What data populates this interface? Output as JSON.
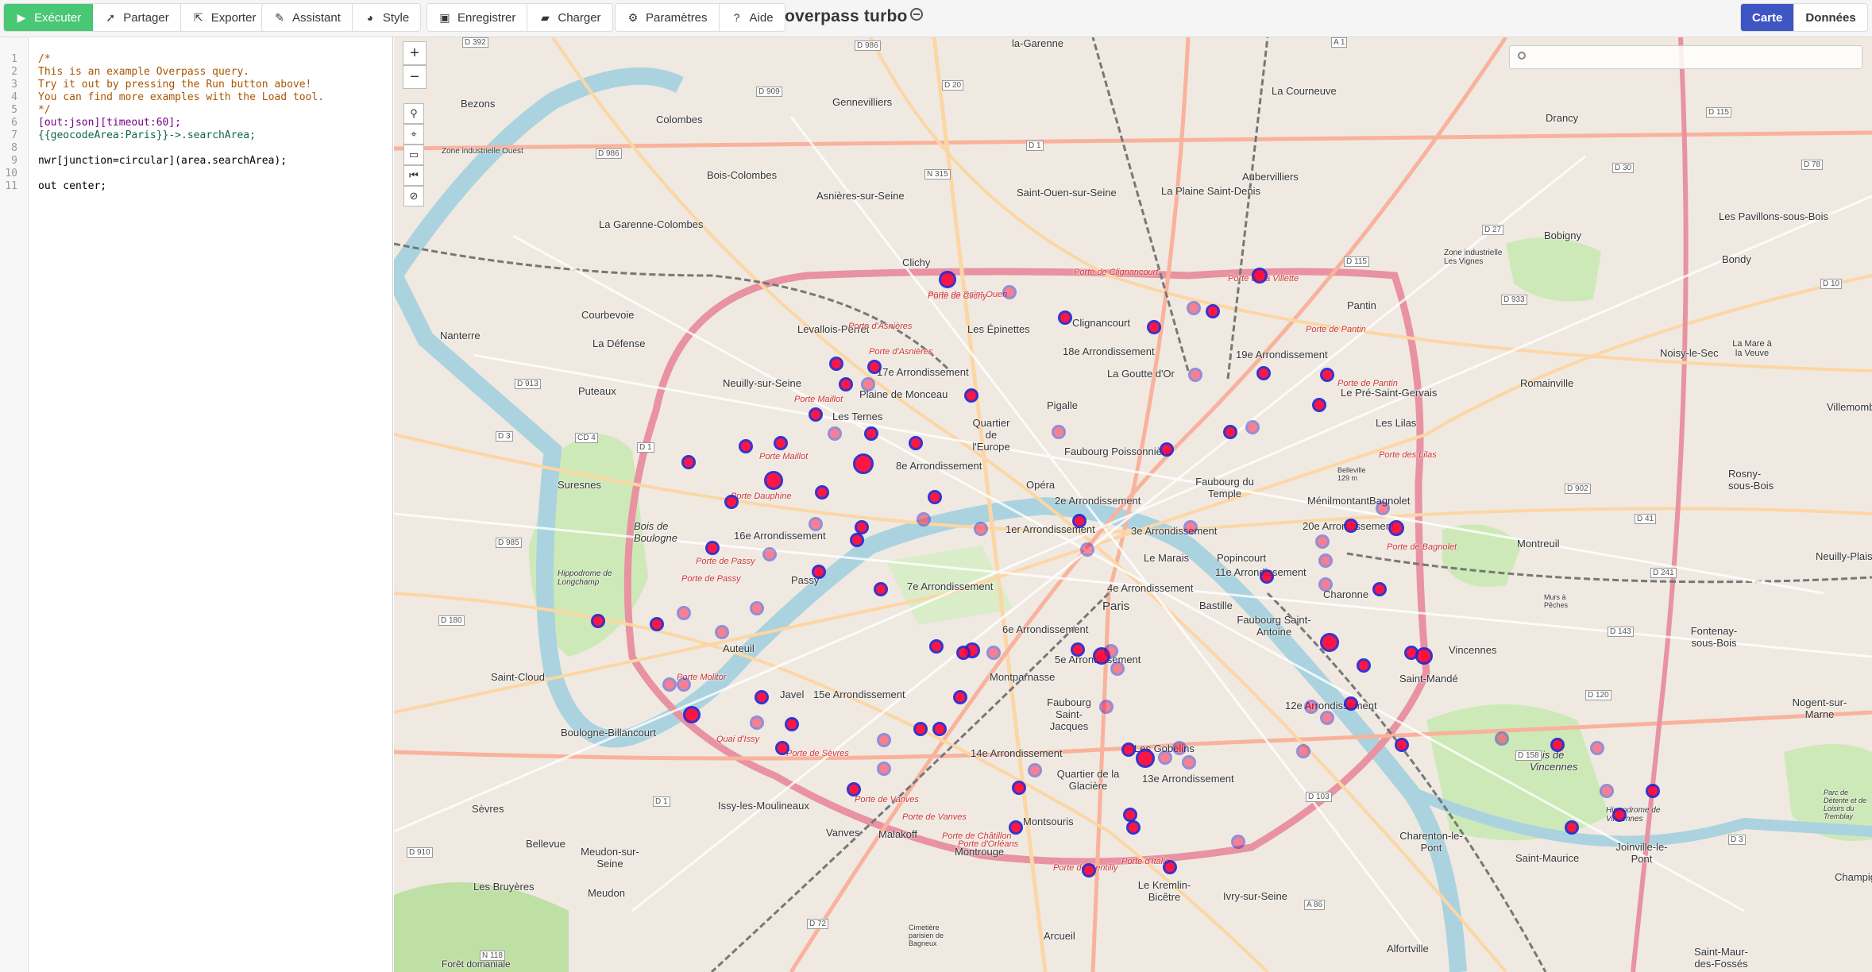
{
  "toolbar": {
    "run": "Exécuter",
    "share": "Partager",
    "export": "Exporter",
    "wizard": "Assistant",
    "style": "Style",
    "save": "Enregistrer",
    "load": "Charger",
    "settings": "Paramètres",
    "help": "Aide",
    "map_tab": "Carte",
    "data_tab": "Données"
  },
  "app_title": "overpass turbo",
  "editor": {
    "line_numbers": [
      "1",
      "2",
      "3",
      "4",
      "5",
      "6",
      "7",
      "8",
      "9",
      "10",
      "11"
    ],
    "lines": [
      "/*",
      "This is an example Overpass query.",
      "Try it out by pressing the Run button above!",
      "You can find more examples with the Load tool.",
      "*/",
      "[out:json][timeout:60];",
      "{{geocodeArea:Paris}}->.searchArea;",
      "",
      "nwr[junction=circular](area.searchArea);",
      "",
      "out center;"
    ]
  },
  "map": {
    "zoom_in": "+",
    "zoom_out": "−",
    "search_placeholder": "",
    "labels": {
      "la_garenne": "la-Garenne",
      "bezons": "Bezons",
      "gennevilliers": "Gennevilliers",
      "colombes": "Colombes",
      "la_courneuve": "La Courneuve",
      "drancy": "Drancy",
      "zone_ind": "Zone industrielle Ouest",
      "bois_colombes": "Bois-Colombes",
      "asnieres": "Asnières-sur-Seine",
      "saint_ouen": "Saint-Ouen-sur-Seine",
      "aubervilliers": "Aubervilliers",
      "plaine_st_denis": "La Plaine Saint-Denis",
      "bobigny": "Bobigny",
      "pavillons": "Les Pavillons-sous-Bois",
      "la_garenne_colombes": "La Garenne-Colombes",
      "clichy": "Clichy",
      "bondy": "Bondy",
      "nanterre": "Nanterre",
      "courbevoie": "Courbevoie",
      "levallois": "Levallois-Perret",
      "epinettes": "Les Épinettes",
      "clignancourt": "Clignancourt",
      "pantin": "Pantin",
      "la_defense": "La Défense",
      "noisy": "Noisy-le-Sec",
      "neuilly": "Neuilly-sur-Seine",
      "arr17": "17e Arrondissement",
      "arr18": "18e Arrondissement",
      "arr19": "19e Arrondissement",
      "romainville": "Romainville",
      "puteaux": "Puteaux",
      "plaine_monceau": "Plaine de Monceau",
      "goutte_or": "La Goutte d'Or",
      "pre_st_gervais": "Le Pré-Saint-Gervais",
      "les_ternes": "Les Ternes",
      "pigalle": "Pigalle",
      "les_lilas": "Les Lilas",
      "quartier_europe": "Quartier de l'Europe",
      "faubourg_poissonniere": "Faubourg Poissonnière",
      "suresnes": "Suresnes",
      "arr8": "8e Arrondissement",
      "faubourg_temple": "Faubourg du Temple",
      "bagnolet": "Bagnolet",
      "rosny": "Rosny-sous-Bois",
      "opera": "Opéra",
      "menilmontant": "Ménilmontant",
      "arr2": "2e Arrondissement",
      "bois_boulogne": "Bois de Boulogne",
      "arr16": "16e Arrondissement",
      "arr1": "1er Arrondissement",
      "arr3": "3e Arrondissement",
      "arr20": "20e Arrondissement",
      "montreuil": "Montreuil",
      "le_marais": "Le Marais",
      "popincourt": "Popincourt",
      "passy": "Passy",
      "arr11": "11e Arrondissement",
      "charonne": "Charonne",
      "arr7": "7e Arrondissement",
      "arr4": "4e Arrondissement",
      "paris": "Paris",
      "bastille": "Bastille",
      "faubourg_st_antoine": "Faubourg Saint-Antoine",
      "auteuil": "Auteuil",
      "arr6": "6e Arrondissement",
      "fontenay": "Fontenay-sous-Bois",
      "saint_cloud": "Saint-Cloud",
      "arr5": "5e Arrondissement",
      "vincennes": "Vincennes",
      "saint_mande": "Saint-Mandé",
      "javel": "Javel",
      "arr15": "15e Arrondissement",
      "montparnasse": "Montparnasse",
      "boulogne": "Boulogne-Billancourt",
      "faubourg_st_jacques": "Faubourg Saint-Jacques",
      "arr12": "12e Arrondissement",
      "nogent": "Nogent-sur-Marne",
      "arr14": "14e Arrondissement",
      "les_gobelins": "Les Gobelins",
      "bois_vincennes": "Bois de Vincennes",
      "arr13": "13e Arrondissement",
      "quartier_glaciere": "Quartier de la Glacière",
      "sevres": "Sèvres",
      "issy": "Issy-les-Moulineaux",
      "charenton": "Charenton-le-Pont",
      "joinville": "Joinville-le-Pont",
      "vanves": "Vanves",
      "malakoff": "Malakoff",
      "montsouris": "Montsouris",
      "meudon_seine": "Meudon-sur-Seine",
      "bellevue": "Bellevue",
      "montrouge": "Montrouge",
      "saint_maurice": "Saint-Maurice",
      "les_bruyeres": "Les Bruyères",
      "meudon": "Meudon",
      "kremlin": "Le Kremlin-Bicêtre",
      "ivry": "Ivry-sur-Seine",
      "arcueil": "Arcueil",
      "alfortville": "Alfortville",
      "saint_maur": "Saint-Maur-des-Fossés",
      "drancy_right": "Drancy",
      "zone_vignes": "Zone industrielle Les Vignes",
      "la_mare": "La Mare à la Veuve",
      "villemomble": "Villemomble",
      "neuilly_plaisance": "Neuilly-Plaisance",
      "porte_maillot": "Porte Maillot",
      "porte_dauphine": "Porte Dauphine",
      "porte_passy": "Porte de Passy",
      "porte_molitor": "Porte Molitor",
      "porte_clignancourt": "Porte de Clignancourt",
      "porte_villette": "Porte de la Villette",
      "porte_pantin": "Porte de Pantin",
      "porte_lilas": "Porte des Lilas",
      "porte_bagnolet": "Porte de Bagnolet",
      "porte_vanves": "Porte de Vanves",
      "porte_chatillon": "Porte de Châtillon",
      "porte_italie": "Porte d'Italie",
      "porte_clichy": "Porte de Clichy",
      "porte_asnieres": "Porte d'Asnières",
      "porte_sevres": "Porte de Sèvres",
      "quai_issy": "Quai d'Issy",
      "porte_st_ouen": "Porte de Saint-Ouen",
      "porte_orleans": "Porte d'Orléans",
      "porte_ivry": "Porte de Gentilly",
      "hippodrome_longchamp": "Hippodrome de Longchamp",
      "hippodrome_vincennes": "Hippodrome de Vincennes",
      "parc_tremblay": "Parc de Détente et de Loisirs du Tremblay",
      "belleville": "Belleville 129 m",
      "bois_pasquier": "Murs à Pêches",
      "cimetiere": "Cimetière parisien de Bagneux",
      "foret_meudon": "Forêt domaniale",
      "champigny": "Champigny",
      "road_d392": "D 392",
      "road_d986": "D 986",
      "road_d909": "D 909",
      "road_d20": "D 20",
      "road_a1": "A 1",
      "road_d115": "D 115",
      "road_d986b": "D 986",
      "road_n315": "N 315",
      "road_d1": "D 1",
      "road_d30": "D 30",
      "road_d78": "D 78",
      "road_d27": "D 27",
      "road_d115b": "D 115",
      "road_d933": "D 933",
      "road_d10": "D 10",
      "road_d913": "D 913",
      "road_d3": "D 3",
      "road_cd4": "CD 4",
      "road_d1b": "D 1",
      "road_d902": "D 902",
      "road_d41": "D 41",
      "road_d985": "D 985",
      "road_d241": "D 241",
      "road_d180": "D 180",
      "road_d143": "D 143",
      "road_d120": "D 120",
      "road_d158": "D 158",
      "road_d103": "D 103",
      "road_d1c": "D 1",
      "road_d910": "D 910",
      "road_d72": "D 72",
      "road_a86": "A 86",
      "road_n118": "N 118",
      "road_d3b": "D 3"
    }
  }
}
